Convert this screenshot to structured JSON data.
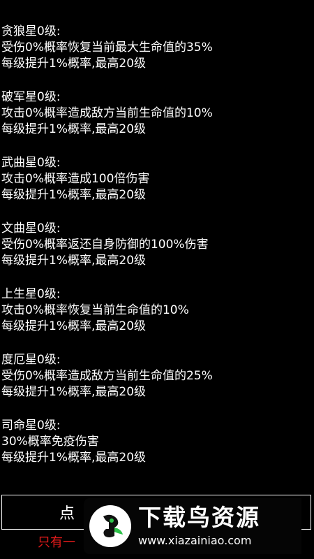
{
  "stars": [
    {
      "title": "贪狼星0级:",
      "effect": "受伤0%概率恢复当前最大生命值的35%",
      "growth": "每级提升1%概率,最高20级"
    },
    {
      "title": "破军星0级:",
      "effect": "攻击0%概率造成敌方当前生命值的10%",
      "growth": "每级提升1%概率,最高20级"
    },
    {
      "title": "武曲星0级:",
      "effect": "攻击0%概率造成100倍伤害",
      "growth": "每级提升1%概率,最高20级"
    },
    {
      "title": "文曲星0级:",
      "effect": "受伤0%概率返还自身防御的100%伤害",
      "growth": "每级提升1%概率,最高20级"
    },
    {
      "title": "上生星0级:",
      "effect": "攻击0%概率恢复当前生命值的10%",
      "growth": "每级提升1%概率,最高20级"
    },
    {
      "title": "度厄星0级:",
      "effect": "受伤0%概率造成敌方当前生命值的25%",
      "growth": "每级提升1%概率,最高20级"
    },
    {
      "title": "司命星0级:",
      "effect": "30%概率免疫伤害",
      "growth": "每级提升1%概率,最高20级"
    }
  ],
  "action_button": {
    "label": "点"
  },
  "bottom_note": "只有一",
  "watermark": {
    "title": "下载鸟资源",
    "url": "www.xiazainiao.com",
    "color": "#2ec24a"
  }
}
